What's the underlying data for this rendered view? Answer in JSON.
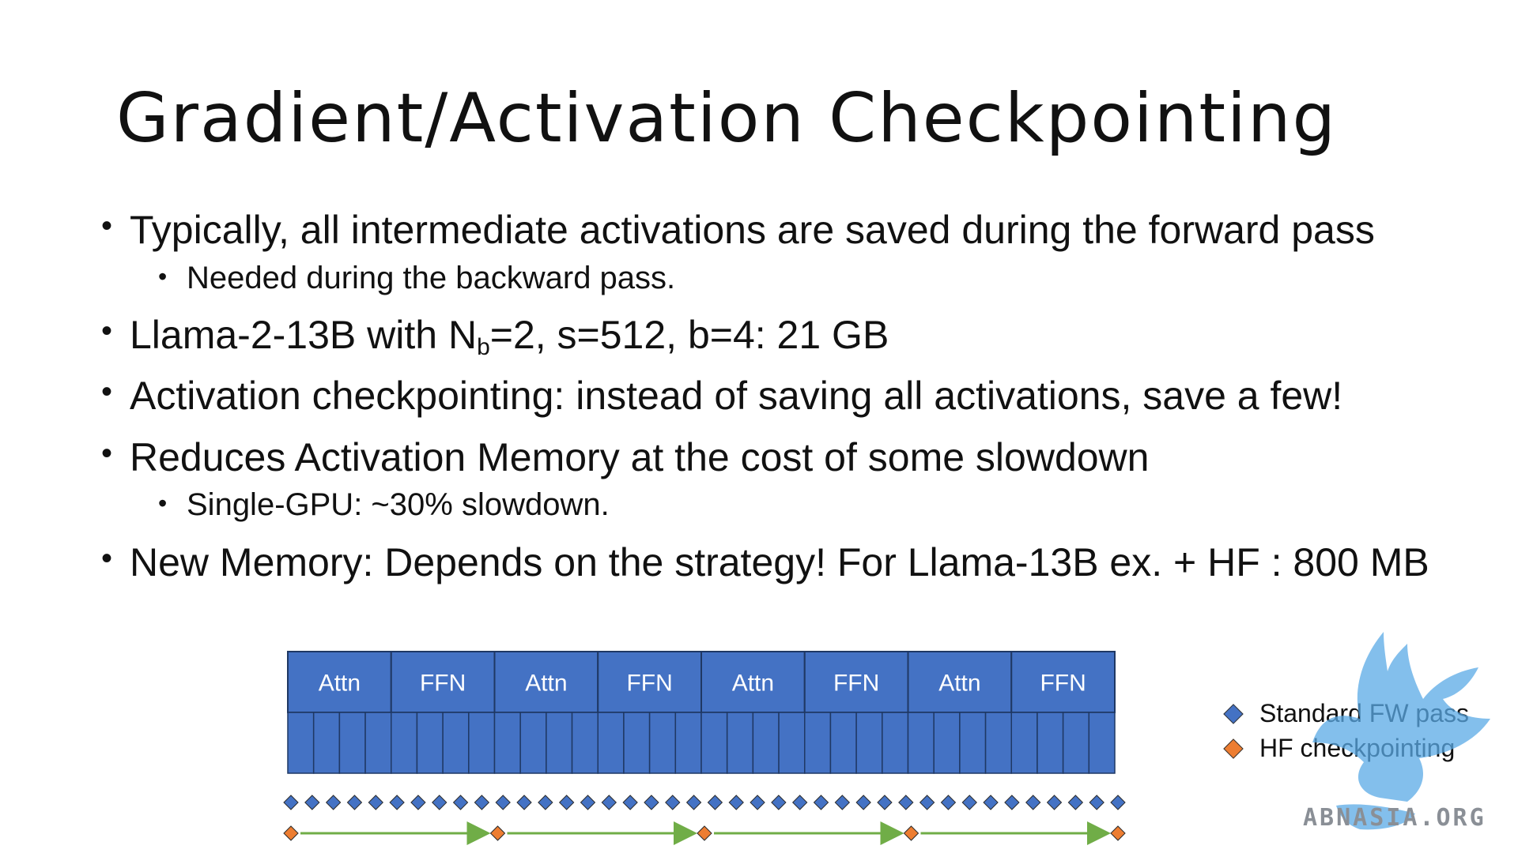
{
  "slide": {
    "title": "Gradient/Activation Checkpointing",
    "bullets": [
      {
        "level": 1,
        "text": "Typically, all intermediate activations are saved during the forward pass"
      },
      {
        "level": 2,
        "text": "Needed during the backward pass."
      },
      {
        "level": 1,
        "text_pre": "Llama-2-13B with N",
        "sub": "b",
        "text_post": "=2, s=512, b=4: 21 GB"
      },
      {
        "level": 1,
        "text": "Activation checkpointing: instead of saving all activations, save a few!"
      },
      {
        "level": 1,
        "text": "Reduces Activation Memory at the cost of some slowdown"
      },
      {
        "level": 2,
        "text": "Single-GPU: ~30% slowdown."
      },
      {
        "level": 1,
        "text": "New Memory: Depends on the strategy! For Llama-13B ex. + HF : 800 MB"
      }
    ],
    "bullet_char": "•"
  },
  "diagram": {
    "blocks": [
      "Attn",
      "FFN",
      "Attn",
      "FFN",
      "Attn",
      "FFN",
      "Attn",
      "FFN"
    ],
    "sub_cells_per_block": 4,
    "standard_markers": 40,
    "checkpoint_markers": 5,
    "colors": {
      "block_fill": "#4472c4",
      "block_border": "#1f3864",
      "standard_marker": "#4472c4",
      "checkpoint_marker": "#ed7d31",
      "arrow": "#70ad47"
    },
    "legend": [
      {
        "label": "Standard FW pass",
        "color": "#4472c4"
      },
      {
        "label": "HF checkpointing",
        "color": "#ed7d31"
      }
    ]
  },
  "watermark": {
    "text": "ABNASIA.ORG",
    "icon": "winged-lion-logo",
    "color": "#5aa9e6"
  }
}
